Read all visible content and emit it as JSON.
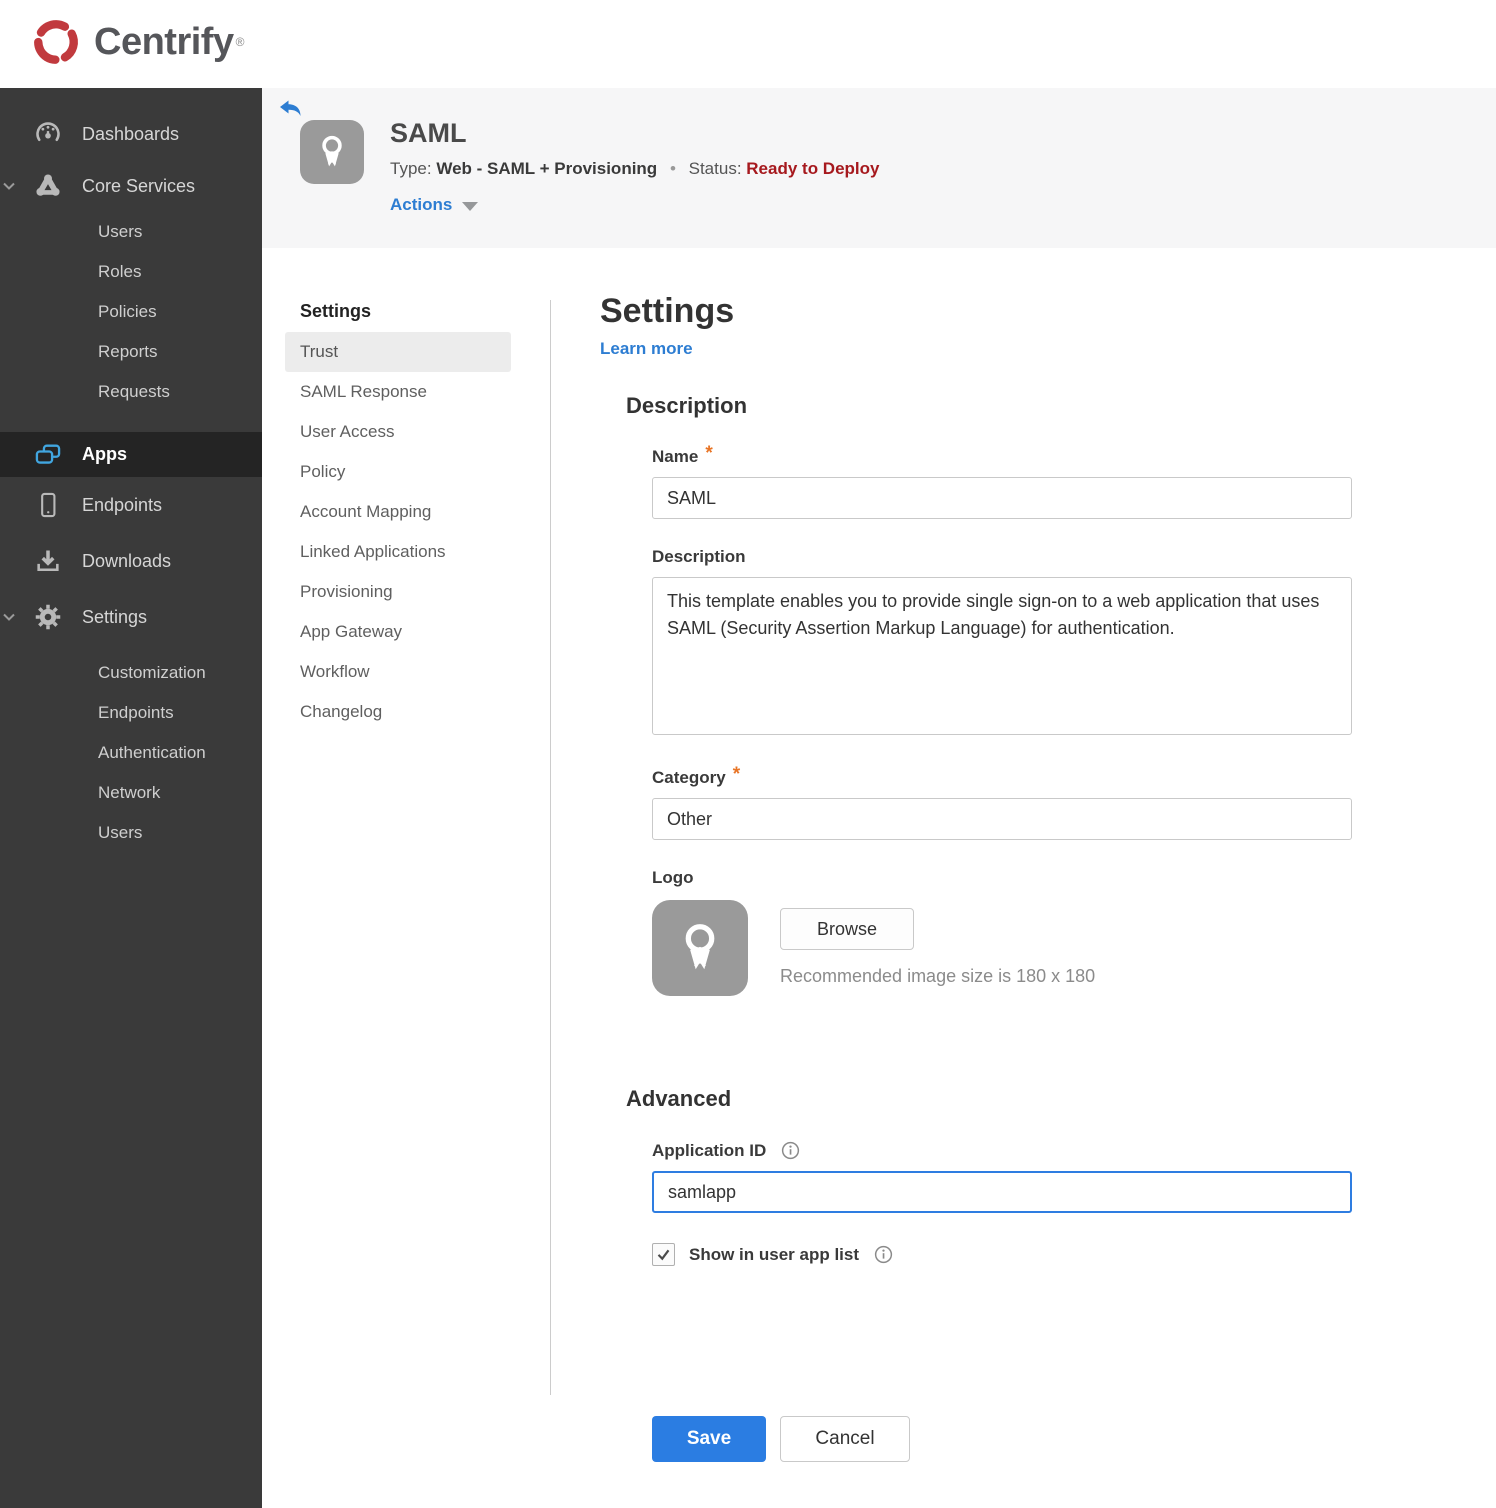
{
  "brand": {
    "name": "Centrify",
    "registered_mark": "®"
  },
  "colors": {
    "logo_red": "#c13a3e",
    "link_blue": "#2d7dd2",
    "accent_blue": "#2b7de2",
    "focus_border_blue": "#2e7de1",
    "status_red": "#a6191e",
    "required_orange": "#e87425",
    "sidebar_bg": "#3a3a3a",
    "sidebar_active_bg": "#242424",
    "apps_icon_blue": "#41a6e0"
  },
  "sidebar": {
    "items": [
      {
        "label": "Dashboards",
        "icon": "gauge-icon"
      },
      {
        "label": "Core Services",
        "icon": "core-services-icon",
        "expanded": true,
        "children": [
          {
            "label": "Users"
          },
          {
            "label": "Roles"
          },
          {
            "label": "Policies"
          },
          {
            "label": "Reports"
          },
          {
            "label": "Requests"
          }
        ]
      },
      {
        "label": "Apps",
        "icon": "apps-icon",
        "active": true
      },
      {
        "label": "Endpoints",
        "icon": "device-icon"
      },
      {
        "label": "Downloads",
        "icon": "download-icon"
      },
      {
        "label": "Settings",
        "icon": "gear-icon",
        "expanded": true,
        "children": [
          {
            "label": "Customization"
          },
          {
            "label": "Endpoints"
          },
          {
            "label": "Authentication"
          },
          {
            "label": "Network"
          },
          {
            "label": "Users"
          }
        ]
      }
    ]
  },
  "app_header": {
    "title": "SAML",
    "type_label": "Type:",
    "type_value": "Web - SAML + Provisioning",
    "dot_separator": "•",
    "status_label": "Status:",
    "status_value": "Ready to Deploy",
    "actions_label": "Actions"
  },
  "subnav": {
    "title": "Settings",
    "active_item": "Trust",
    "items": [
      {
        "label": "Trust"
      },
      {
        "label": "SAML Response"
      },
      {
        "label": "User Access"
      },
      {
        "label": "Policy"
      },
      {
        "label": "Account Mapping"
      },
      {
        "label": "Linked Applications"
      },
      {
        "label": "Provisioning"
      },
      {
        "label": "App Gateway"
      },
      {
        "label": "Workflow"
      },
      {
        "label": "Changelog"
      }
    ]
  },
  "main": {
    "title": "Settings",
    "learn_more_label": "Learn more",
    "required_marker": "*",
    "description": {
      "heading": "Description",
      "name_label": "Name",
      "name_value": "SAML",
      "description_label": "Description",
      "description_value": "This template enables you to provide single sign-on to a web application that uses SAML (Security Assertion Markup Language) for authentication.",
      "category_label": "Category",
      "category_value": "Other",
      "logo_label": "Logo",
      "browse_label": "Browse",
      "recommended_text": "Recommended image size is 180 x 180"
    },
    "advanced": {
      "heading": "Advanced",
      "application_id_label": "Application ID",
      "application_id_value": "samlapp",
      "show_in_user_app_list_label": "Show in user app list",
      "show_in_user_app_list_checked": true
    },
    "footer": {
      "save_label": "Save",
      "cancel_label": "Cancel"
    }
  }
}
